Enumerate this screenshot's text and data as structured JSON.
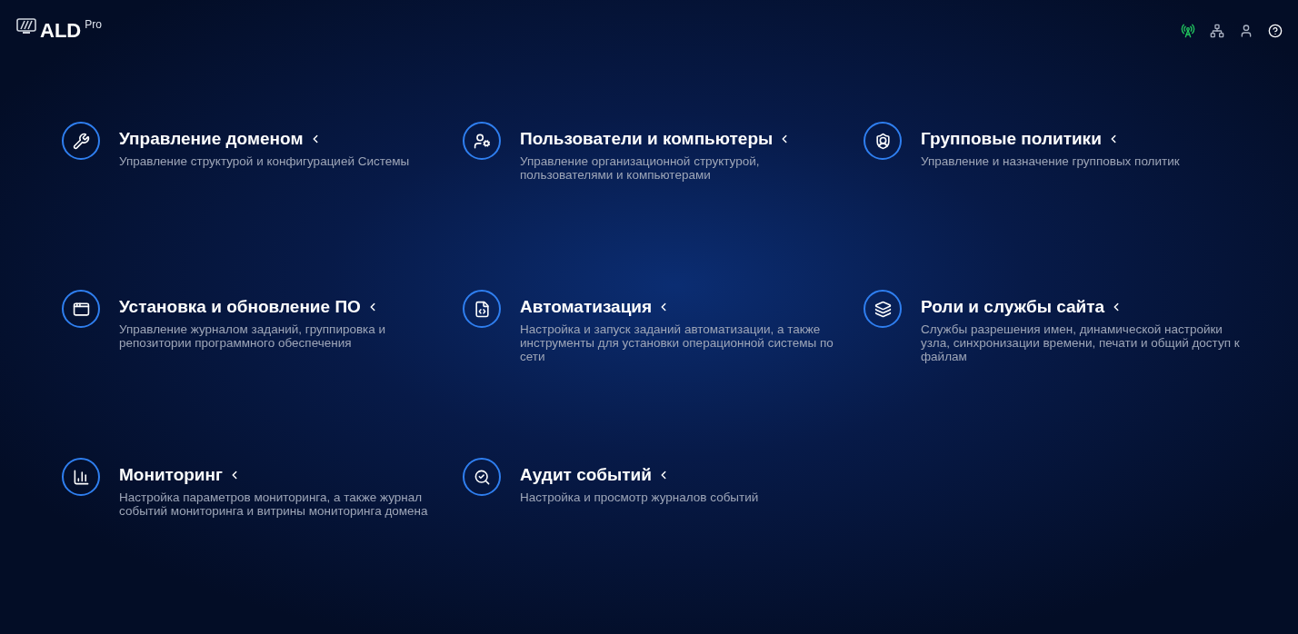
{
  "logo": {
    "name": "ALD",
    "suffix": "Pro"
  },
  "header_icons": [
    {
      "kind": "antenna"
    },
    {
      "kind": "network"
    },
    {
      "kind": "user"
    },
    {
      "kind": "help"
    }
  ],
  "sections": [
    {
      "kind": "tools",
      "title": "Управление доменом",
      "description": "Управление структурой и конфигурацией Системы"
    },
    {
      "kind": "user-gear",
      "title": "Пользователи и компьютеры",
      "description": "Управление организационной структурой, пользователями и компьютерами"
    },
    {
      "kind": "shield-user",
      "title": "Групповые политики",
      "description": "Управление и назначение групповых политик"
    },
    {
      "kind": "window",
      "title": "Установка и обновление ПО",
      "description": "Управление журналом заданий, группировка и репозитории программного обеспечения"
    },
    {
      "kind": "file-code",
      "title": "Автоматизация",
      "description": "Настройка и запуск заданий автоматизации, а также инструменты для установки операционной системы по сети"
    },
    {
      "kind": "layers",
      "title": "Роли и службы сайта",
      "description": "Службы разрешения имен, динамической настройки узла, синхронизации времени, печати и общий доступ к файлам"
    },
    {
      "kind": "chart",
      "title": "Мониторинг",
      "description": "Настройка параметров мониторинга, а также журнал событий мониторинга и витрины мониторинга домена"
    },
    {
      "kind": "search",
      "title": "Аудит событий",
      "description": "Настройка и просмотр журналов событий"
    }
  ]
}
